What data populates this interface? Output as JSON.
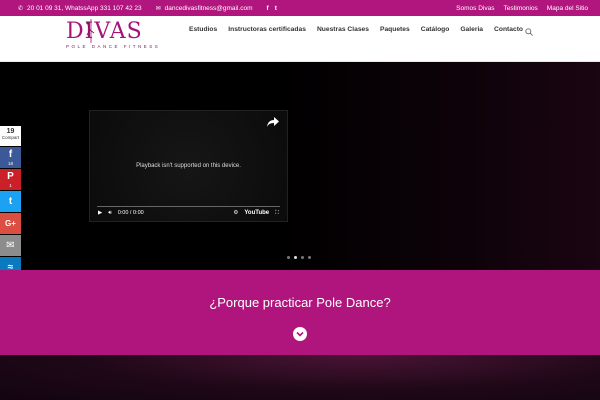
{
  "topbar": {
    "phone": "20 01 09 31, WhatssApp 331 107 42 23",
    "email": "dancedivasfitness@gmail.com",
    "social": [
      "f",
      "t"
    ],
    "links": [
      "Somos Divas",
      "Testimonios",
      "Mapa del Sitio"
    ]
  },
  "logo": {
    "word": "DIVAS",
    "tagline": "POLE DANCE FITNESS"
  },
  "nav": {
    "items": [
      "Estudios",
      "Instructoras certificadas",
      "Nuestras Clases",
      "Paquetes",
      "Catálogo",
      "Galeria",
      "Contacto"
    ]
  },
  "video": {
    "message": "Playback isn't supported on this device.",
    "time": "0:00 / 0:00",
    "brand": "YouTube"
  },
  "slider": {
    "dots": 4,
    "active": 2
  },
  "share": {
    "count": "19",
    "count_label": "Compart",
    "buttons": [
      {
        "name": "facebook",
        "glyph": "f",
        "count": "18",
        "color": "#3b5998"
      },
      {
        "name": "pinterest",
        "glyph": "P",
        "count": "1",
        "color": "#cb2027"
      },
      {
        "name": "twitter",
        "glyph": "t",
        "count": "",
        "color": "#1da1f2"
      },
      {
        "name": "google-plus",
        "glyph": "G+",
        "count": "",
        "color": "#dc4e41"
      },
      {
        "name": "email",
        "glyph": "✉",
        "count": "",
        "color": "#8c8c8c"
      },
      {
        "name": "sumo",
        "glyph": "≈",
        "count": "",
        "color": "#0a79c0"
      }
    ]
  },
  "section": {
    "headline": "¿Porque practicar Pole Dance?"
  },
  "colors": {
    "brand": "#b0157d",
    "topbar": "#b1157e"
  }
}
